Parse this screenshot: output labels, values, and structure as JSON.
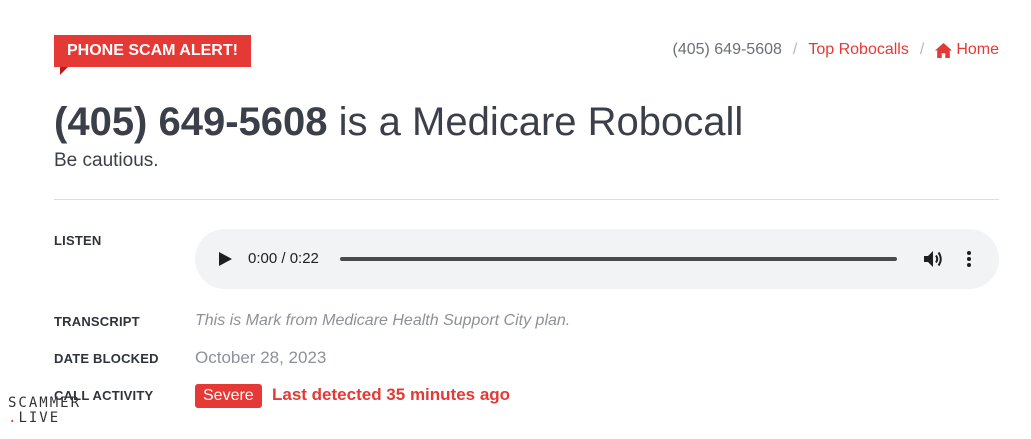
{
  "alert": {
    "label": "PHONE SCAM ALERT!"
  },
  "breadcrumb": {
    "current": "(405) 649-5608",
    "separator": "/",
    "top_robocalls": "Top Robocalls",
    "home": "Home"
  },
  "heading": {
    "number": "(405) 649-5608",
    "suffix": " is a Medicare Robocall",
    "subtitle": "Be cautious."
  },
  "details": {
    "listen_label": "LISTEN",
    "transcript_label": "TRANSCRIPT",
    "transcript": "This is Mark from Medicare Health Support City plan.",
    "date_label": "DATE BLOCKED",
    "date": "October 28, 2023",
    "activity_label": "CALL ACTIVITY",
    "severity": "Severe",
    "last_detected": "Last detected 35 minutes ago"
  },
  "player": {
    "time": "0:00 / 0:22",
    "progress": 0
  },
  "watermark": {
    "line1": "SCAMMER",
    "line2": "LIVE"
  },
  "colors": {
    "accent": "#e53935",
    "text": "#3a3f4a",
    "muted": "#8e9199",
    "player_bg": "#f1f3f4"
  },
  "icons": {
    "home": "home-icon",
    "play": "play-icon",
    "volume": "volume-icon",
    "menu": "more-vert-icon"
  }
}
